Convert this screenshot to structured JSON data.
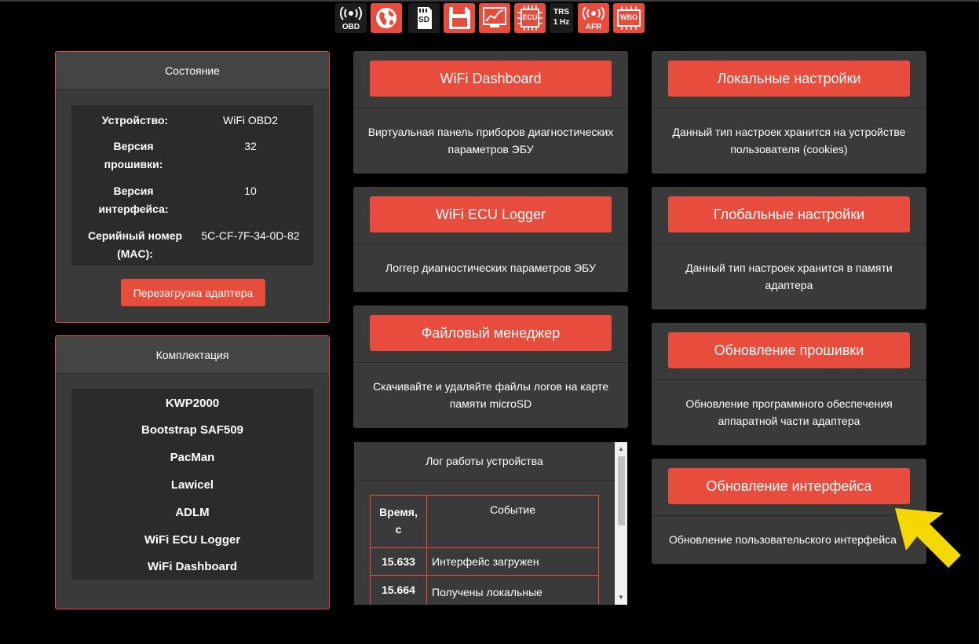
{
  "icons": {
    "obd_label": "OBD",
    "sd_label": "SD",
    "ecu_label": "ECU",
    "trs_line1": "TRS",
    "trs_line2": "1 Hz",
    "afr_label": "AFR",
    "wbo_label": "WBO"
  },
  "state": {
    "title": "Состояние",
    "rows": [
      {
        "key": "Устройство:",
        "value": "WiFi OBD2"
      },
      {
        "key": "Версия прошивки:",
        "value": "32"
      },
      {
        "key": "Версия интерфейса:",
        "value": "10"
      },
      {
        "key": "Серийный номер (MAC):",
        "value": "5C-CF-7F-34-0D-82"
      }
    ],
    "reboot_button": "Перезагрузка адаптера"
  },
  "kit": {
    "title": "Комплектация",
    "items": [
      "KWP2000",
      "Bootstrap SAF509",
      "PacMan",
      "Lawicel",
      "ADLM",
      "WiFi ECU Logger",
      "WiFi Dashboard"
    ]
  },
  "cards": {
    "dashboard": {
      "button": "WiFi Dashboard",
      "desc": "Виртуальная панель приборов диагностических параметров ЭБУ"
    },
    "logger": {
      "button": "WiFi ECU Logger",
      "desc": "Логгер диагностических параметров ЭБУ"
    },
    "files": {
      "button": "Файловый менеджер",
      "desc": "Скачивайте и удаляйте файлы логов на карте памяти microSD"
    },
    "local": {
      "button": "Локальные настройки",
      "desc": "Данный тип настроек хранится на устройстве пользователя (cookies)"
    },
    "global": {
      "button": "Глобальные настройки",
      "desc": "Данный тип настроек хранится в памяти адаптера"
    },
    "firmware": {
      "button": "Обновление прошивки",
      "desc": "Обновление программного обеспечения аппаратной части адаптера"
    },
    "ui": {
      "button": "Обновление интерфейса",
      "desc": "Обновление пользовательского интерфейса"
    }
  },
  "log": {
    "title": "Лог работы устройства",
    "col_time": "Время, с",
    "col_event": "Событие",
    "rows": [
      {
        "time": "15.633",
        "event": "Интерфейс загружен"
      },
      {
        "time": "15.664",
        "event": "Получены локальные настройки адаптера"
      }
    ]
  },
  "colors": {
    "accent": "#e74c3c",
    "panel": "#3a3a3a",
    "arrow": "#f5d800"
  }
}
